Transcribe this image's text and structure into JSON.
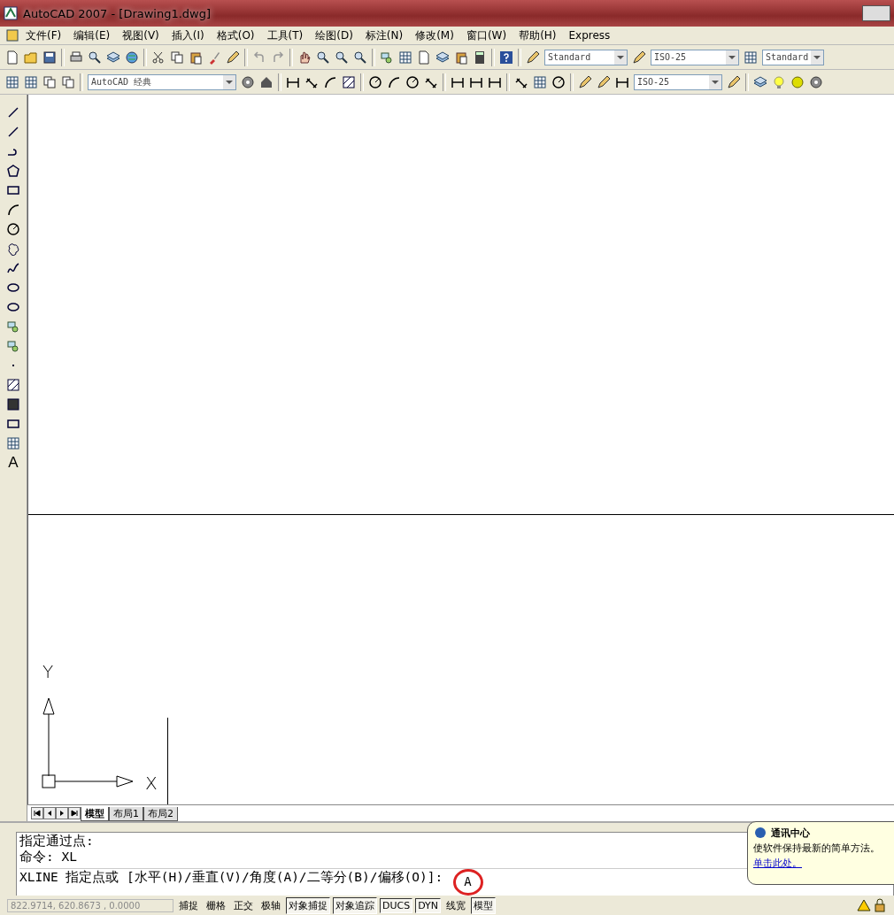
{
  "window": {
    "title": "AutoCAD 2007 - [Drawing1.dwg]"
  },
  "menu": [
    "文件(F)",
    "编辑(E)",
    "视图(V)",
    "插入(I)",
    "格式(O)",
    "工具(T)",
    "绘图(D)",
    "标注(N)",
    "修改(M)",
    "窗口(W)",
    "帮助(H)",
    "Express"
  ],
  "toolbar_1": {
    "text_style": "Standard",
    "dim_style": "ISO-25",
    "table_style": "Standard"
  },
  "toolbar_2": {
    "workspace": "AutoCAD 经典",
    "dim_style": "ISO-25"
  },
  "draw_toolbar": {
    "mtext_button": "A"
  },
  "ucs": {
    "y_label": "Y",
    "x_label": "X"
  },
  "layout_tabs": [
    {
      "label": "模型",
      "selected": true
    },
    {
      "label": "布局1",
      "selected": false
    },
    {
      "label": "布局2",
      "selected": false
    }
  ],
  "command": {
    "history": [
      "指定通过点:",
      "命令: XL"
    ],
    "prompt": "XLINE 指定点或 [水平(H)/垂直(V)/角度(A)/二等分(B)/偏移(O)]:",
    "value": "A",
    "highlighted": true
  },
  "status_bar": {
    "coordinates": "822.9714,  620.8673 , 0.0000",
    "toggles": [
      {
        "label": "捕捉",
        "on": false
      },
      {
        "label": "栅格",
        "on": false
      },
      {
        "label": "正交",
        "on": false
      },
      {
        "label": "极轴",
        "on": false
      },
      {
        "label": "对象捕捉",
        "on": true
      },
      {
        "label": "对象追踪",
        "on": true
      },
      {
        "label": "DUCS",
        "on": true
      },
      {
        "label": "DYN",
        "on": true
      },
      {
        "label": "线宽",
        "on": false
      },
      {
        "label": "模型",
        "on": true
      }
    ]
  },
  "notification": {
    "title": "通讯中心",
    "message": "使软件保持最新的简单方法。",
    "link": "单击此处。"
  }
}
